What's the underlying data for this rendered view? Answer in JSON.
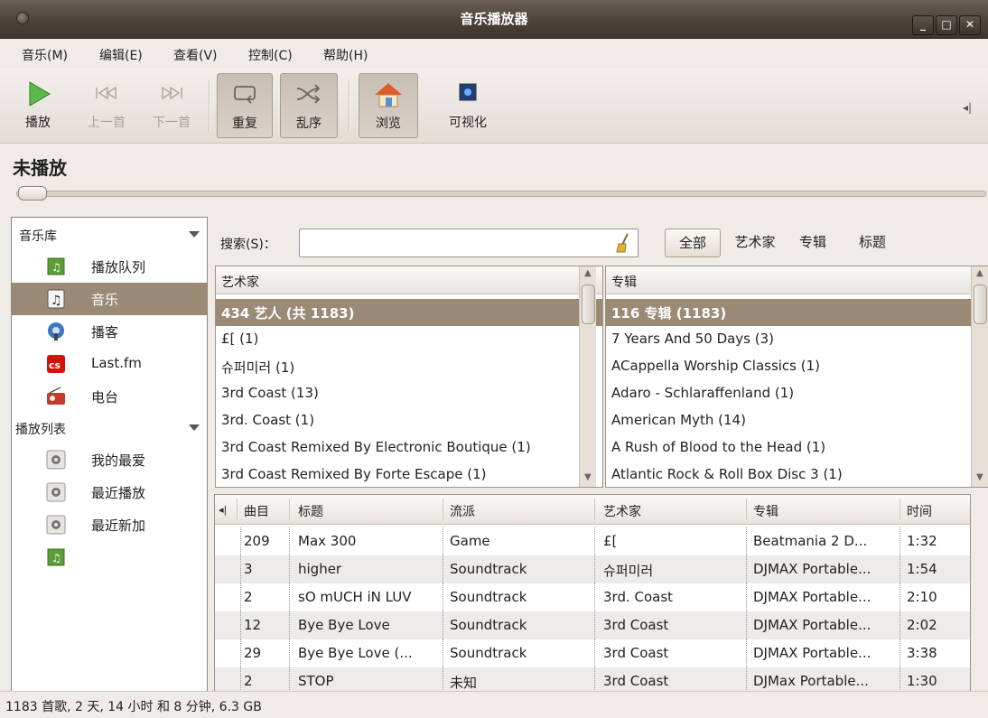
{
  "window": {
    "title": "音乐播放器"
  },
  "menubar": [
    {
      "label": "音乐(M)"
    },
    {
      "label": "编辑(E)"
    },
    {
      "label": "查看(V)"
    },
    {
      "label": "控制(C)"
    },
    {
      "label": "帮助(H)"
    }
  ],
  "toolbar": {
    "play": "播放",
    "prev": "上一首",
    "next": "下一首",
    "repeat": "重复",
    "shuffle": "乱序",
    "browse": "浏览",
    "visualize": "可视化"
  },
  "now_playing": "未播放",
  "seek_progress": 0,
  "sidebar": {
    "library_header": "音乐库",
    "library_items": [
      {
        "label": "播放队列",
        "icon": "queue-icon"
      },
      {
        "label": "音乐",
        "icon": "music-note-icon"
      },
      {
        "label": "播客",
        "icon": "podcast-icon"
      },
      {
        "label": "Last.fm",
        "icon": "lastfm-icon"
      },
      {
        "label": "电台",
        "icon": "radio-icon"
      }
    ],
    "playlists_header": "播放列表",
    "playlist_items": [
      {
        "label": "我的最爱",
        "icon": "gear-icon"
      },
      {
        "label": "最近播放",
        "icon": "gear-icon"
      },
      {
        "label": "最近新加",
        "icon": "gear-icon"
      },
      {
        "label": "",
        "icon": "playlist-icon"
      }
    ]
  },
  "search": {
    "label": "搜索(S)：",
    "value": "",
    "filters": [
      "全部",
      "艺术家",
      "专辑",
      "标题"
    ]
  },
  "artists": {
    "header": "艺术家",
    "rows": [
      "434 艺人 (共 1183)",
      "£[ (1)",
      "슈퍼미러 (1)",
      "3rd Coast (13)",
      "3rd. Coast (1)",
      "3rd Coast Remixed By Electronic Boutique (1)",
      "3rd Coast Remixed By Forte Escape (1)"
    ]
  },
  "albums": {
    "header": "专辑",
    "rows": [
      "116 专辑 (1183)",
      "7 Years And 50 Days (3)",
      "ACappella Worship Classics (1)",
      "Adaro - Schlaraffenland (1)",
      "American Myth (14)",
      "A Rush of Blood to the Head (1)",
      "Atlantic Rock & Roll Box Disc 3 (1)"
    ]
  },
  "tracks": {
    "columns": [
      "曲目",
      "标题",
      "流派",
      "艺术家",
      "专辑",
      "时间"
    ],
    "rows": [
      {
        "num": "209",
        "title": "Max 300",
        "genre": "Game",
        "artist": "£[",
        "album": "Beatmania 2 D...",
        "time": "1:32"
      },
      {
        "num": "3",
        "title": "higher",
        "genre": "Soundtrack",
        "artist": "슈퍼미러",
        "album": "DJMAX Portable...",
        "time": "1:54"
      },
      {
        "num": "2",
        "title": "sO mUCH iN LUV",
        "genre": "Soundtrack",
        "artist": "3rd. Coast",
        "album": "DJMAX Portable...",
        "time": "2:10"
      },
      {
        "num": "12",
        "title": "Bye Bye Love",
        "genre": "Soundtrack",
        "artist": "3rd Coast",
        "album": "DJMAX Portable...",
        "time": "2:02"
      },
      {
        "num": "29",
        "title": "Bye Bye Love (...",
        "genre": "Soundtrack",
        "artist": "3rd Coast",
        "album": "DJMAX Portable...",
        "time": "3:38"
      },
      {
        "num": "2",
        "title": "STOP",
        "genre": "未知",
        "artist": "3rd Coast",
        "album": "DJMax Portable...",
        "time": "1:30"
      }
    ]
  },
  "status": "1183 首歌, 2 天, 14 小时 和 8 分钟, 6.3 GB",
  "colors": {
    "selection": "#9a8a76",
    "titlebar": "#4c433b",
    "accent_play": "#4caf3a"
  }
}
